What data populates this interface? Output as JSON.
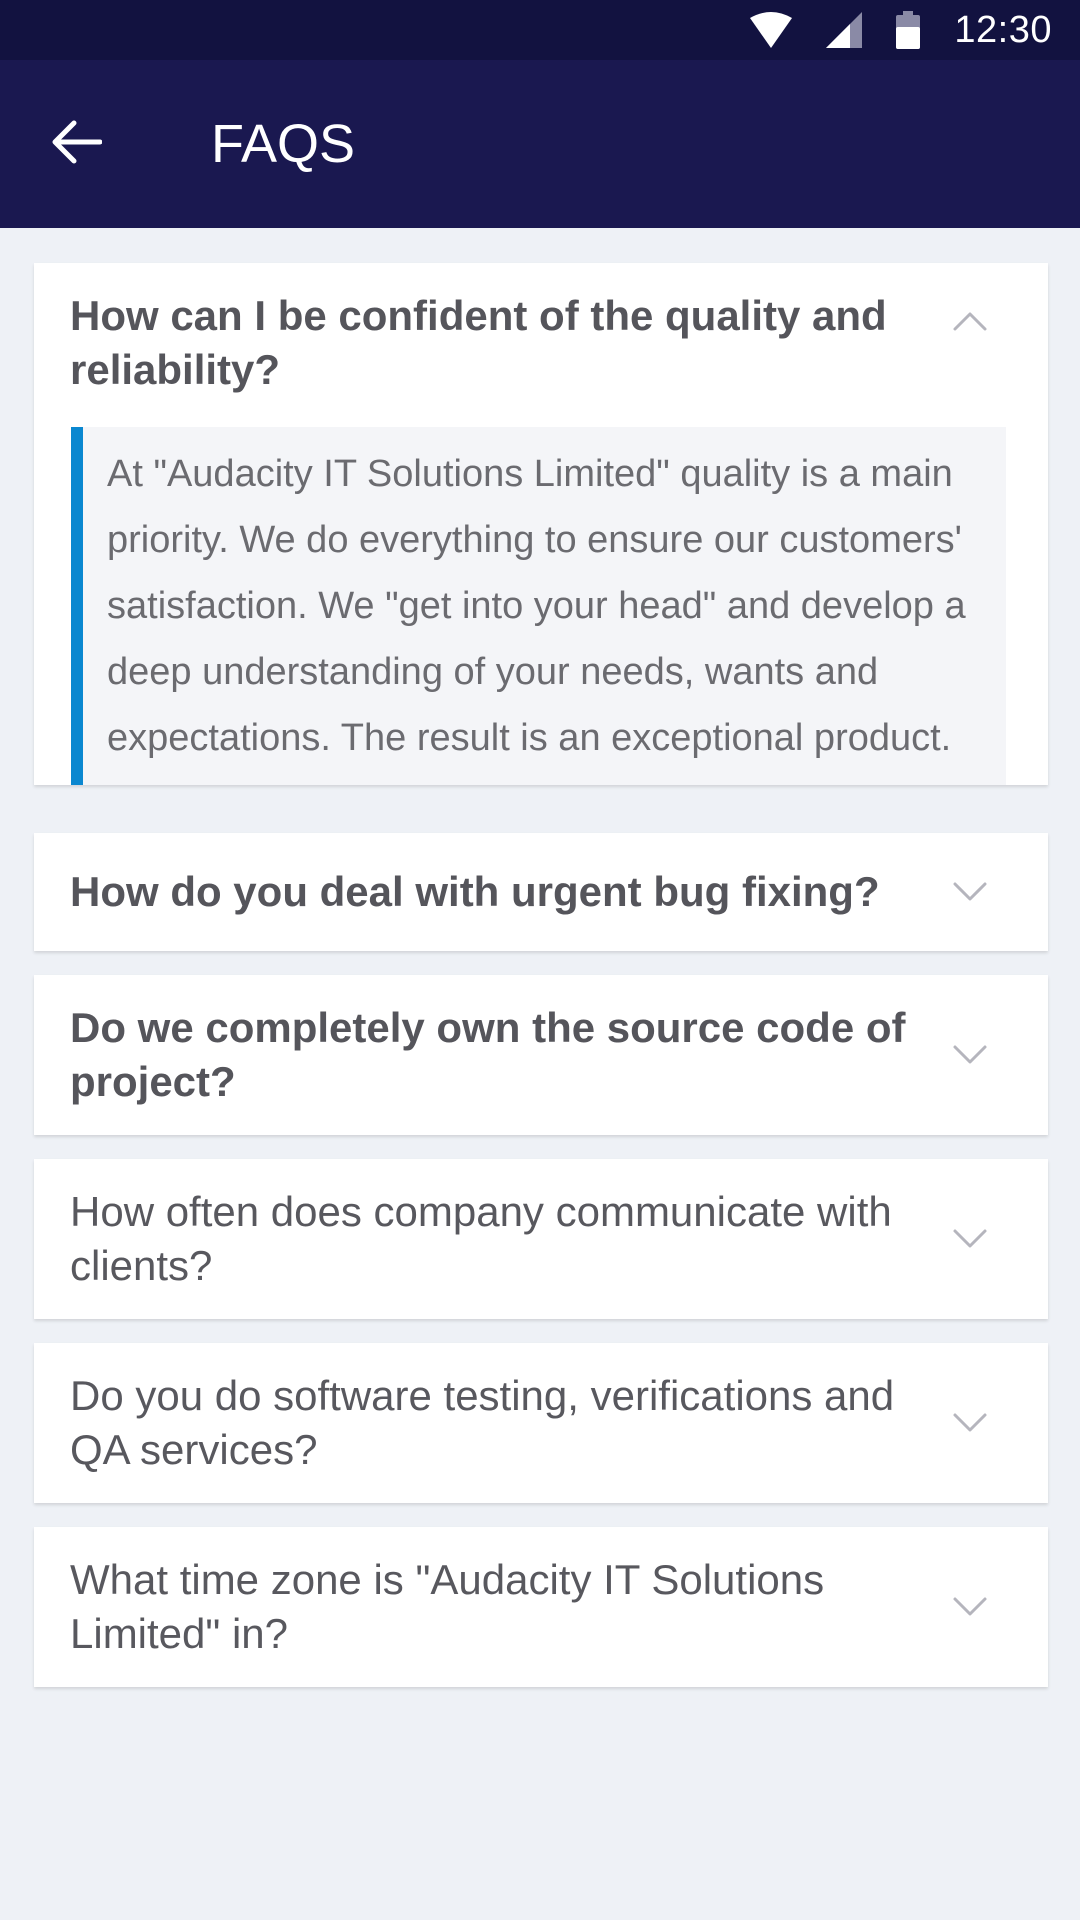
{
  "status_bar": {
    "time": "12:30",
    "icons": [
      "wifi-icon",
      "cellular-signal-icon",
      "battery-icon"
    ]
  },
  "app_bar": {
    "title": "FAQS",
    "back_icon": "arrow-left-icon"
  },
  "colors": {
    "status_bar": "#121240",
    "app_bar": "#1a1850",
    "page_background": "#eef1f6",
    "accent": "#0a87d0",
    "question_text": "#58585e",
    "answer_text": "#6b6b70"
  },
  "faqs": [
    {
      "question": "How can I be confident of the quality and reliability?",
      "expanded": true,
      "answer": "At \"Audacity IT Solutions Limited\" quality is a main priority. We do everything to ensure our customers' satisfaction. We \"get into your head\" and develop a deep understanding of your needs, wants and expectations. The result is an exceptional product."
    },
    {
      "question": "How do you deal with urgent bug fixing?",
      "expanded": false
    },
    {
      "question": "Do we completely own the source code of project?",
      "expanded": false
    },
    {
      "question": "How often does company communicate with clients?",
      "expanded": false
    },
    {
      "question": "Do you do software testing, verifications and QA services?",
      "expanded": false
    },
    {
      "question": "What time zone is \"Audacity IT Solutions Limited\" in?",
      "expanded": false
    }
  ]
}
